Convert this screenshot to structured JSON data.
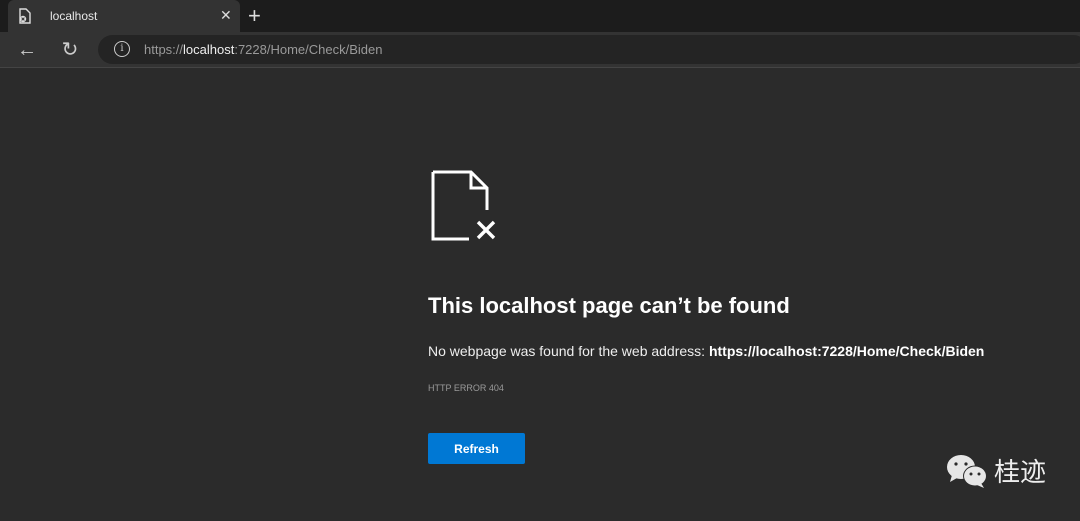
{
  "tab": {
    "title": "localhost",
    "close_icon": "close-icon",
    "favicon": "page-error-icon"
  },
  "new_tab_label": "+",
  "toolbar": {
    "back_icon": "arrow-left-icon",
    "reload_icon": "reload-icon",
    "info_icon": "info-icon",
    "url_prefix": "https://",
    "url_host": "localhost",
    "url_rest": ":7228/Home/Check/Biden"
  },
  "error": {
    "icon": "file-x-icon",
    "title": "This localhost page can’t be found",
    "desc_prefix": "No webpage was found for the web address:",
    "desc_url": "https://localhost:7228/Home/Check/Biden",
    "code": "HTTP ERROR 404",
    "refresh_label": "Refresh"
  },
  "watermark": {
    "text": "桂迹",
    "icon": "wechat-icon"
  },
  "colors": {
    "accent": "#0078d4",
    "background": "#2b2b2b"
  }
}
